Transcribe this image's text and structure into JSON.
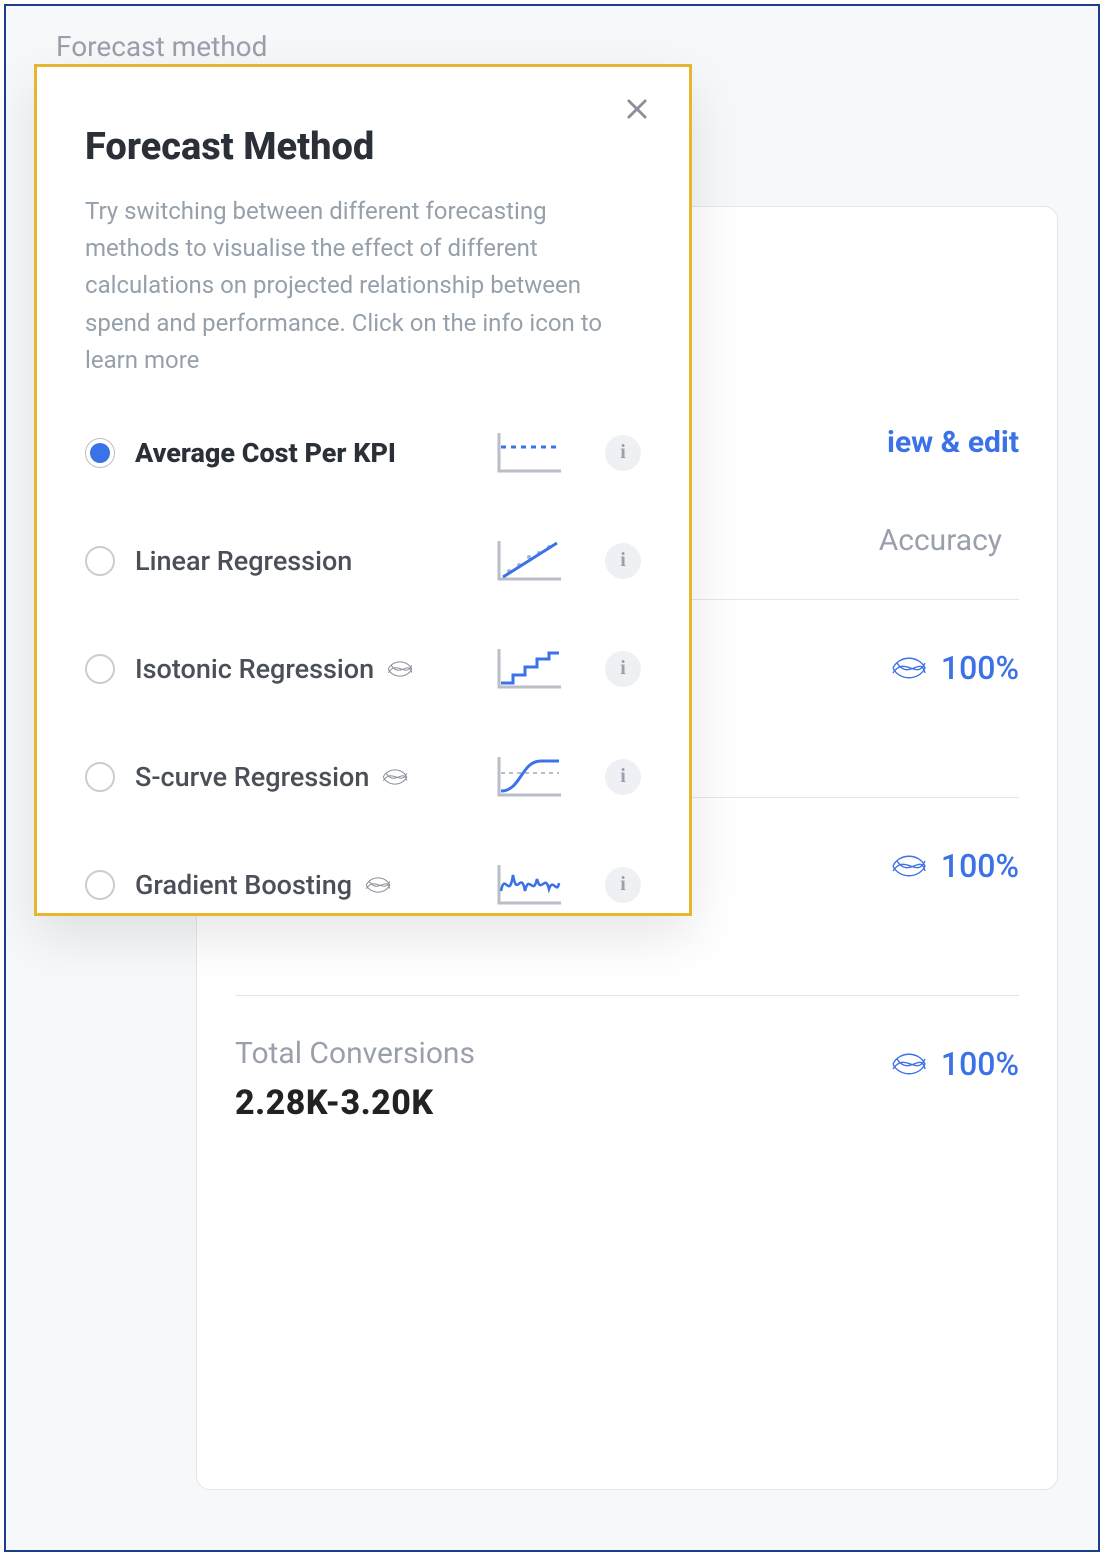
{
  "background": {
    "section_label": "Forecast method"
  },
  "card": {
    "link_label": "iew & edit",
    "header_accuracy": "Accuracy",
    "metrics": [
      {
        "label": "",
        "value": "",
        "accuracy": "100%"
      },
      {
        "label": "",
        "value": "",
        "accuracy": "100%"
      },
      {
        "label": "Total Conversions",
        "value": "2.28K-3.20K",
        "accuracy": "100%"
      }
    ]
  },
  "modal": {
    "title": "Forecast Method",
    "description": "Try switching between different forecasting methods to visualise the effect of different calculations on projected relationship between spend and performance. Click on the info icon to learn more",
    "options": [
      {
        "label": "Average Cost Per KPI",
        "selected": true,
        "has_scribble": false,
        "chart": "flat"
      },
      {
        "label": "Linear Regression",
        "selected": false,
        "has_scribble": false,
        "chart": "linear"
      },
      {
        "label": "Isotonic Regression",
        "selected": false,
        "has_scribble": true,
        "chart": "steps"
      },
      {
        "label": "S-curve Regression",
        "selected": false,
        "has_scribble": true,
        "chart": "scurve"
      },
      {
        "label": "Gradient Boosting",
        "selected": false,
        "has_scribble": true,
        "chart": "wave"
      }
    ],
    "info_glyph": "i"
  }
}
